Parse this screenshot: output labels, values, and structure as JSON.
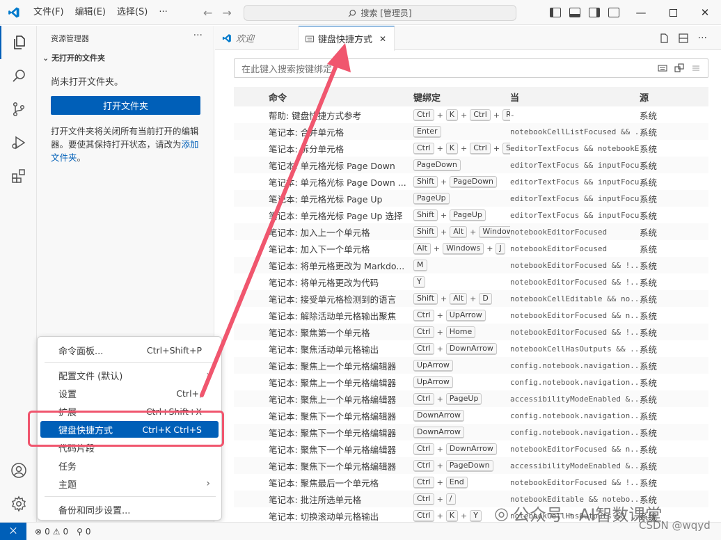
{
  "titlebar": {
    "menus": [
      "文件(F)",
      "编辑(E)",
      "选择(S)",
      "···"
    ],
    "search": "搜索 [管理员]",
    "controls": [
      "minimize",
      "maximize",
      "close"
    ]
  },
  "sidebar": {
    "title": "资源管理器",
    "more": "···",
    "section": "无打开的文件夹",
    "empty_text": "尚未打开文件夹。",
    "open_button": "打开文件夹",
    "desc": "打开文件夹将关闭所有当前打开的编辑器。要使其保持打开状态，请改为",
    "link": "添加文件夹",
    "link_suffix": "。"
  },
  "tabs": [
    {
      "label": "欢迎",
      "active": false
    },
    {
      "label": "键盘快捷方式",
      "active": true,
      "close": "✕"
    }
  ],
  "keybindings": {
    "search_placeholder": "在此键入搜索按键绑定",
    "headers": {
      "command": "命令",
      "keybinding": "键绑定",
      "when": "当",
      "source": "源"
    },
    "rows": [
      {
        "command": "帮助: 键盘快捷方式参考",
        "keys": [
          "Ctrl",
          "K",
          "Ctrl",
          "R"
        ],
        "when": "-",
        "source": "系统"
      },
      {
        "command": "笔记本: 合并单元格",
        "keys": [
          "Enter"
        ],
        "when": "notebookCellListFocused && ...",
        "source": "系统"
      },
      {
        "command": "笔记本: 拆分单元格",
        "keys": [
          "Ctrl",
          "K",
          "Ctrl",
          "Shift"
        ],
        "when": "editorTextFocus && notebookEditorFocused",
        "source": "系统"
      },
      {
        "command": "笔记本: 单元格光标 Page Down",
        "keys": [
          "PageDown"
        ],
        "when": "editorTextFocus && inputFocus",
        "source": "系统"
      },
      {
        "command": "笔记本: 单元格光标 Page Down ...",
        "keys": [
          "Shift",
          "PageDown"
        ],
        "when": "editorTextFocus && inputFocus",
        "source": "系统"
      },
      {
        "command": "笔记本: 单元格光标 Page Up",
        "keys": [
          "PageUp"
        ],
        "when": "editorTextFocus && inputFocus",
        "source": "系统"
      },
      {
        "command": "笔记本: 单元格光标 Page Up 选择",
        "keys": [
          "Shift",
          "PageUp"
        ],
        "when": "editorTextFocus && inputFocus",
        "source": "系统"
      },
      {
        "command": "笔记本: 加入上一个单元格",
        "keys": [
          "Shift",
          "Alt",
          "Windows"
        ],
        "when": "notebookEditorFocused",
        "source": "系统"
      },
      {
        "command": "笔记本: 加入下一个单元格",
        "keys": [
          "Alt",
          "Windows",
          "J"
        ],
        "when": "notebookEditorFocused",
        "source": "系统"
      },
      {
        "command": "笔记本: 将单元格更改为 Markdo...",
        "keys": [
          "M"
        ],
        "when": "notebookEditorFocused && !...",
        "source": "系统"
      },
      {
        "command": "笔记本: 将单元格更改为代码",
        "keys": [
          "Y"
        ],
        "when": "notebookEditorFocused && !...",
        "source": "系统"
      },
      {
        "command": "笔记本: 接受单元格检测到的语言",
        "keys": [
          "Shift",
          "Alt",
          "D"
        ],
        "when": "notebookCellEditable && no...",
        "source": "系统"
      },
      {
        "command": "笔记本: 解除活动单元格输出聚焦",
        "keys": [
          "Ctrl",
          "UpArrow"
        ],
        "when": "notebookEditorFocused && n...",
        "source": "系统"
      },
      {
        "command": "笔记本: 聚焦第一个单元格",
        "keys": [
          "Ctrl",
          "Home"
        ],
        "when": "notebookEditorFocused && !...",
        "source": "系统"
      },
      {
        "command": "笔记本: 聚焦活动单元格输出",
        "keys": [
          "Ctrl",
          "DownArrow"
        ],
        "when": "notebookCellHasOutputs && ...",
        "source": "系统"
      },
      {
        "command": "笔记本: 聚焦上一个单元格编辑器",
        "keys": [
          "UpArrow"
        ],
        "when": "config.notebook.navigation...",
        "source": "系统"
      },
      {
        "command": "笔记本: 聚焦上一个单元格编辑器",
        "keys": [
          "UpArrow"
        ],
        "when": "config.notebook.navigation...",
        "source": "系统"
      },
      {
        "command": "笔记本: 聚焦上一个单元格编辑器",
        "keys": [
          "Ctrl",
          "PageUp"
        ],
        "when": "accessibilityModeEnabled &...",
        "source": "系统"
      },
      {
        "command": "笔记本: 聚焦下一个单元格编辑器",
        "keys": [
          "DownArrow"
        ],
        "when": "config.notebook.navigation...",
        "source": "系统"
      },
      {
        "command": "笔记本: 聚焦下一个单元格编辑器",
        "keys": [
          "DownArrow"
        ],
        "when": "config.notebook.navigation...",
        "source": "系统"
      },
      {
        "command": "笔记本: 聚焦下一个单元格编辑器",
        "keys": [
          "Ctrl",
          "DownArrow"
        ],
        "when": "notebookEditorFocused && n...",
        "source": "系统"
      },
      {
        "command": "笔记本: 聚焦下一个单元格编辑器",
        "keys": [
          "Ctrl",
          "PageDown"
        ],
        "when": "accessibilityModeEnabled &...",
        "source": "系统"
      },
      {
        "command": "笔记本: 聚焦最后一个单元格",
        "keys": [
          "Ctrl",
          "End"
        ],
        "when": "notebookEditorFocused && !...",
        "source": "系统"
      },
      {
        "command": "笔记本: 批注所选单元格",
        "keys": [
          "Ctrl",
          "/"
        ],
        "when": "notebookEditable && notebo...",
        "source": "系统"
      },
      {
        "command": "笔记本: 切换滚动单元格输出",
        "keys": [
          "Ctrl",
          "K",
          "Y"
        ],
        "when": "notebookCellHasOutputs && ...",
        "source": "系统"
      }
    ]
  },
  "context_menu": {
    "items": [
      {
        "label": "命令面板...",
        "shortcut": "Ctrl+Shift+P",
        "highlight": false
      },
      {
        "label": "配置文件 (默认)",
        "shortcut": "",
        "submenu": true,
        "highlight": false
      },
      {
        "label": "设置",
        "shortcut": "Ctrl+,",
        "highlight": false
      },
      {
        "label": "扩展",
        "shortcut": "Ctrl+Shift+X",
        "highlight": false
      },
      {
        "label": "键盘快捷方式",
        "shortcut": "Ctrl+K Ctrl+S",
        "highlight": true
      },
      {
        "label": "代码片段",
        "shortcut": "",
        "highlight": false
      },
      {
        "label": "任务",
        "shortcut": "",
        "highlight": false
      },
      {
        "label": "主题",
        "shortcut": "",
        "submenu": true,
        "highlight": false
      },
      {
        "label": "备份和同步设置...",
        "shortcut": "",
        "highlight": false
      }
    ]
  },
  "statusbar": {
    "errors": "0",
    "warnings": "0",
    "ports": "0"
  },
  "watermark": {
    "text": "公众号 · AI智数课堂",
    "csdn": "CSDN @wqyd"
  },
  "colors": {
    "accent": "#005fb8",
    "annotation": "#f0566e"
  }
}
